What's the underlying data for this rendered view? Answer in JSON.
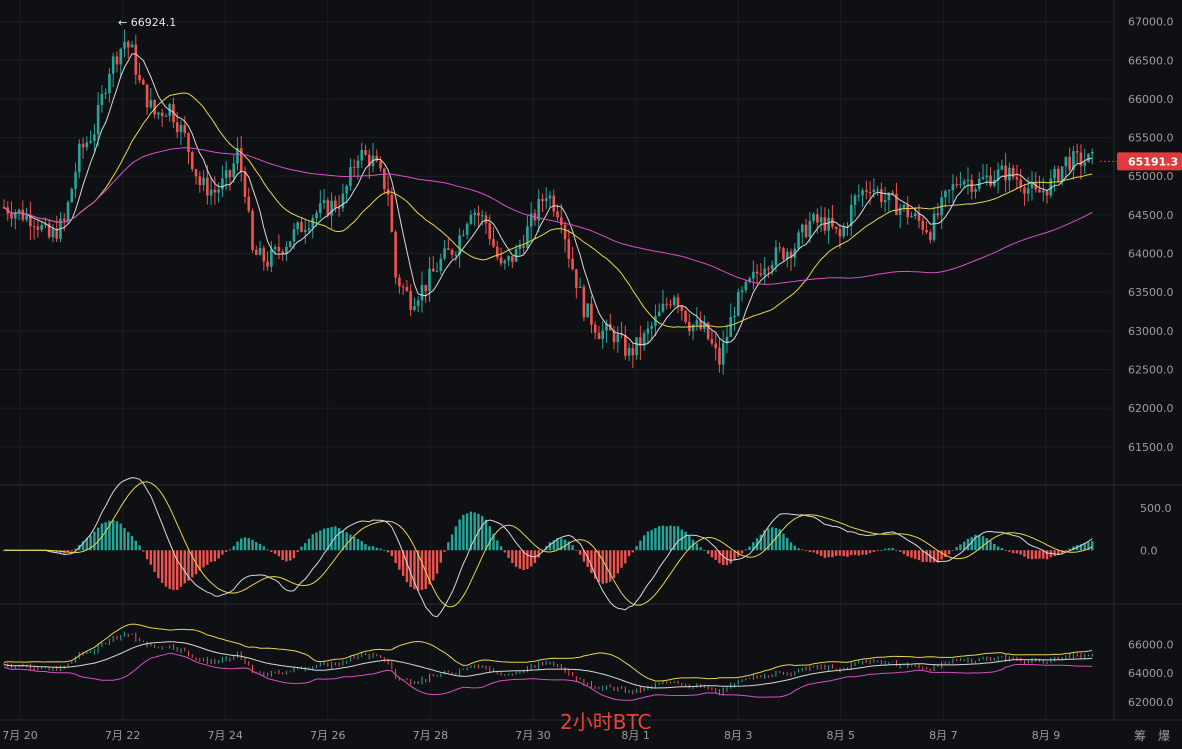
{
  "title": "2小时BTC",
  "corner_label": "筹 爆",
  "colors": {
    "up": "#26a69a",
    "down": "#ef5350",
    "ma_white": "#d9d9d9",
    "ma_yellow": "#e8d44d",
    "ma_pink": "#d94fc8",
    "grid": "#1c1e22",
    "bg": "#0f1013",
    "tag": "#e0393e"
  },
  "chart_data": {
    "type": "candlestick",
    "title": "2小时BTC",
    "last_price": "65191.3",
    "high_marker": "← 66924.1",
    "x_tick_labels": [
      "7月 20",
      "7月 22",
      "7月 24",
      "7月 26",
      "7月 28",
      "7月 30",
      "8月 1",
      "8月 3",
      "8月 5",
      "8月 7",
      "8月 9"
    ],
    "main_panel": {
      "y_ticks": [
        67000,
        66500,
        66000,
        65500,
        65000,
        64500,
        64000,
        63500,
        63000,
        62500,
        62000,
        61500
      ],
      "ylim": [
        61200,
        67150
      ],
      "tick_labels": [
        "67000.0",
        "66500.0",
        "66000.0",
        "65500.0",
        "65000.0",
        "64500.0",
        "64000.0",
        "63500.0",
        "63000.0",
        "62500.0",
        "62000.0",
        "61500.0"
      ]
    },
    "macd_panel": {
      "tick_labels": [
        "500.0",
        "0.0"
      ],
      "y_ticks": [
        500,
        0
      ],
      "ylim": [
        -550,
        650
      ]
    },
    "lower_panel": {
      "tick_labels": [
        "66000.0",
        "64000.0",
        "62000.0"
      ],
      "y_ticks": [
        66000,
        64000,
        62000
      ],
      "ylim": [
        61300,
        67700
      ]
    },
    "closes_keypoints": [
      [
        0,
        64600
      ],
      [
        8,
        64450
      ],
      [
        12,
        64200
      ],
      [
        16,
        64400
      ],
      [
        20,
        65300
      ],
      [
        24,
        65600
      ],
      [
        28,
        66400
      ],
      [
        32,
        66750
      ],
      [
        34,
        66600
      ],
      [
        36,
        66200
      ],
      [
        40,
        65800
      ],
      [
        44,
        65900
      ],
      [
        48,
        65500
      ],
      [
        52,
        64900
      ],
      [
        56,
        64800
      ],
      [
        60,
        65000
      ],
      [
        62,
        65300
      ],
      [
        64,
        64850
      ],
      [
        66,
        64000
      ],
      [
        70,
        63900
      ],
      [
        74,
        64100
      ],
      [
        78,
        64300
      ],
      [
        82,
        64500
      ],
      [
        86,
        64600
      ],
      [
        90,
        64700
      ],
      [
        94,
        65300
      ],
      [
        98,
        65200
      ],
      [
        102,
        64800
      ],
      [
        104,
        63700
      ],
      [
        108,
        63400
      ],
      [
        112,
        63600
      ],
      [
        116,
        63900
      ],
      [
        120,
        64100
      ],
      [
        124,
        64600
      ],
      [
        128,
        64400
      ],
      [
        132,
        63800
      ],
      [
        136,
        64000
      ],
      [
        140,
        64400
      ],
      [
        144,
        64800
      ],
      [
        148,
        64500
      ],
      [
        150,
        64000
      ],
      [
        154,
        63300
      ],
      [
        158,
        63000
      ],
      [
        162,
        62950
      ],
      [
        166,
        62700
      ],
      [
        170,
        62900
      ],
      [
        174,
        63200
      ],
      [
        178,
        63500
      ],
      [
        182,
        63100
      ],
      [
        186,
        63000
      ],
      [
        188,
        62800
      ],
      [
        190,
        62600
      ],
      [
        194,
        63300
      ],
      [
        198,
        63600
      ],
      [
        202,
        63900
      ],
      [
        206,
        64000
      ],
      [
        210,
        64100
      ],
      [
        214,
        64400
      ],
      [
        218,
        64400
      ],
      [
        222,
        64200
      ],
      [
        226,
        64700
      ],
      [
        230,
        64900
      ],
      [
        234,
        64700
      ],
      [
        238,
        64600
      ],
      [
        242,
        64450
      ],
      [
        246,
        64300
      ],
      [
        250,
        64700
      ],
      [
        254,
        65000
      ],
      [
        258,
        64900
      ],
      [
        262,
        65000
      ],
      [
        266,
        65050
      ],
      [
        270,
        64950
      ],
      [
        274,
        64750
      ],
      [
        278,
        64900
      ],
      [
        282,
        65200
      ]
    ]
  }
}
